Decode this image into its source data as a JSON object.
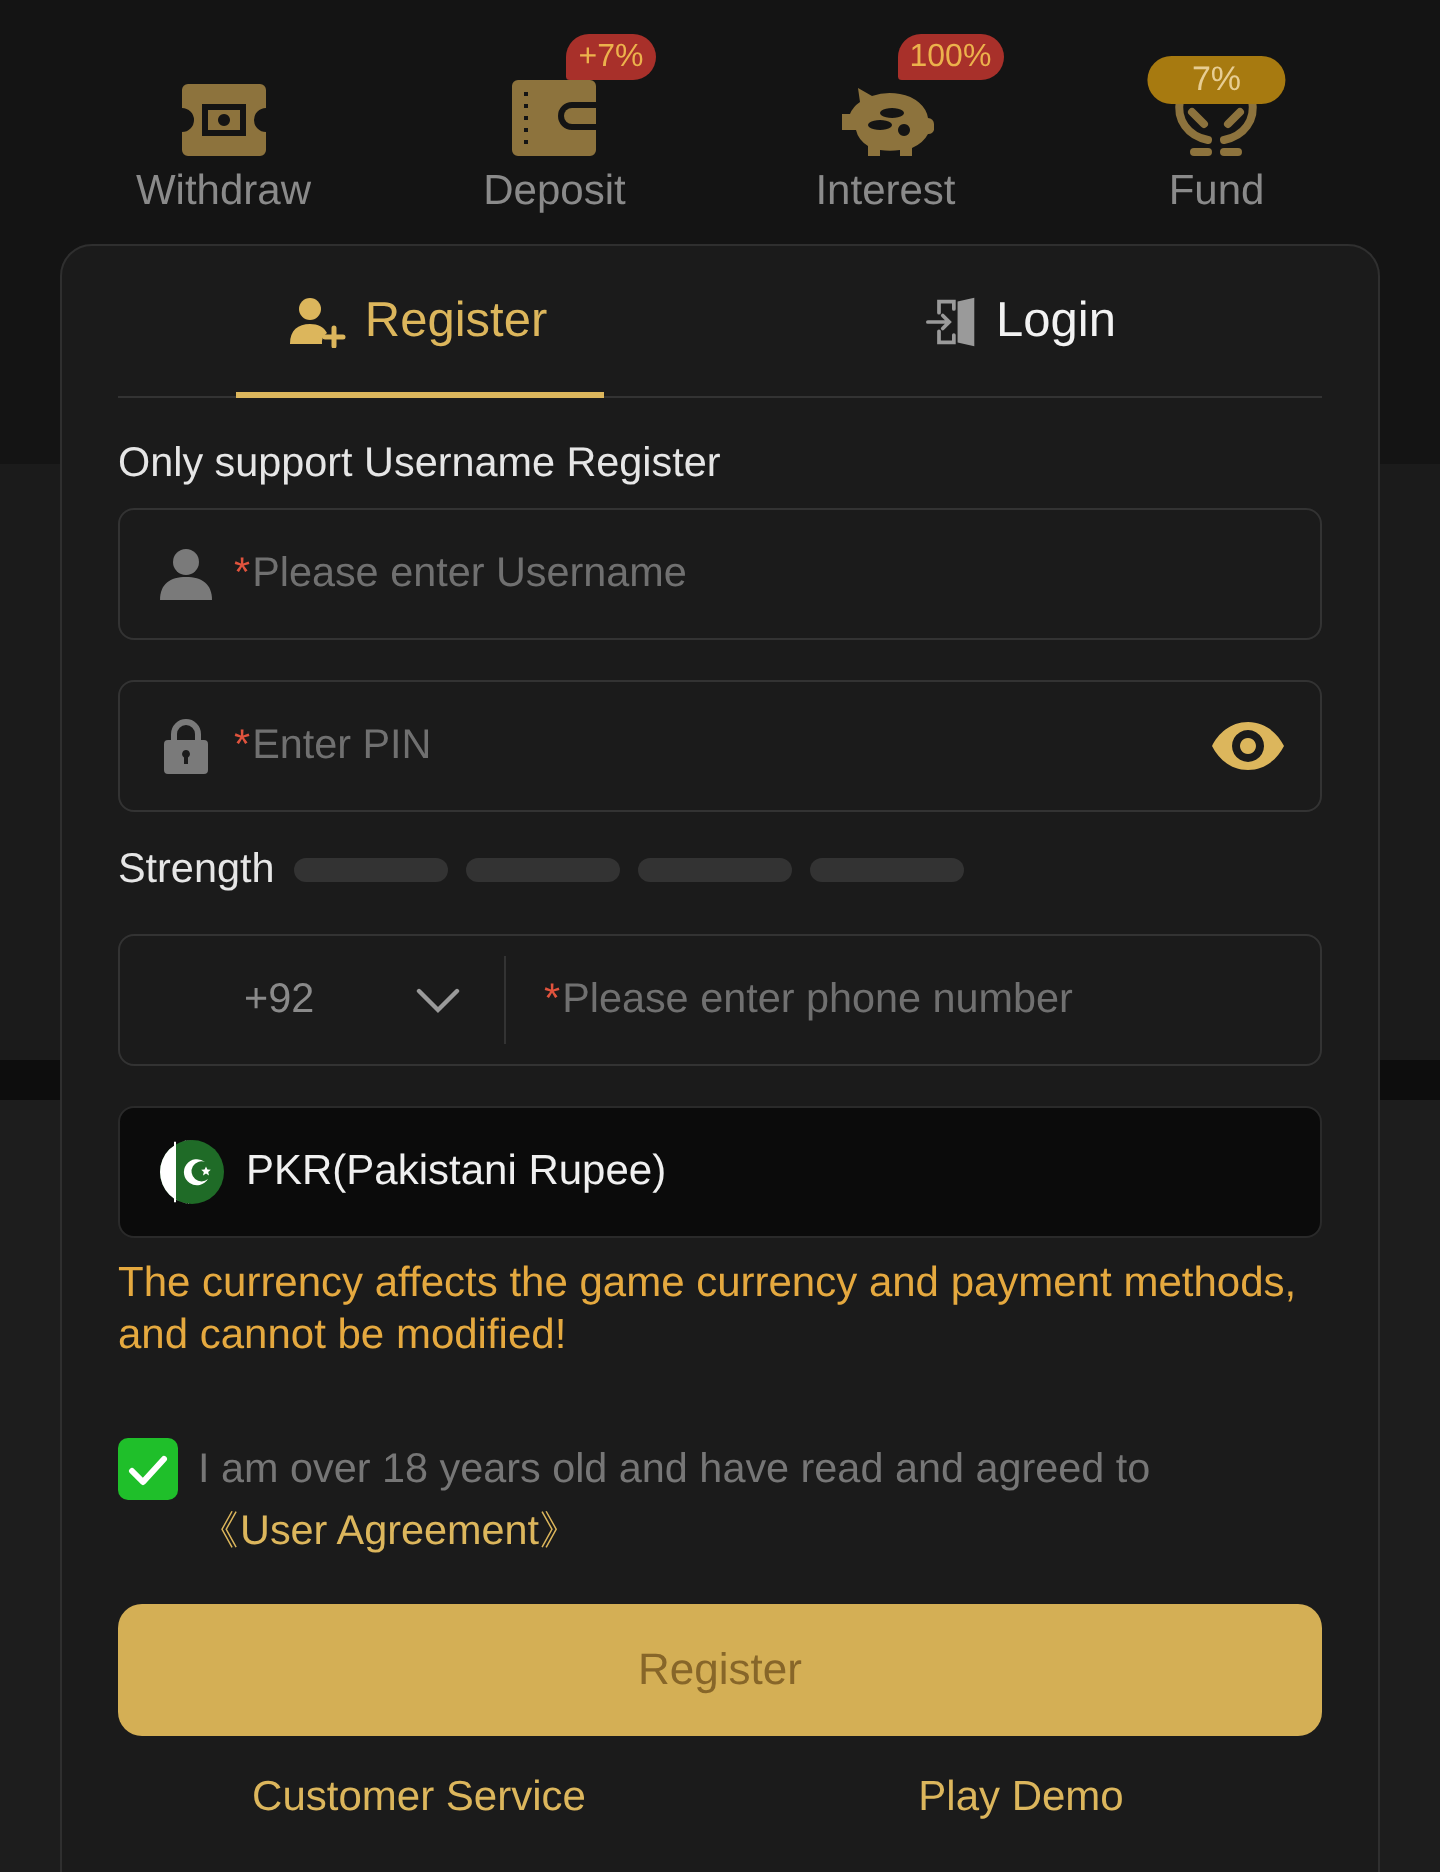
{
  "shortcuts": [
    {
      "label": "Withdraw"
    },
    {
      "label": "Deposit",
      "badge": {
        "text": "+7%",
        "kind": "bubble",
        "color": "#a8302a"
      }
    },
    {
      "label": "Interest",
      "badge": {
        "text": "100%",
        "kind": "bubble",
        "color": "#a8302a"
      }
    },
    {
      "label": "Fund",
      "badge": {
        "text": "7%",
        "kind": "pill",
        "color": "#a77a10"
      }
    }
  ],
  "tabs": [
    {
      "label": "Register",
      "selected": true
    },
    {
      "label": "Login",
      "selected": false
    }
  ],
  "form": {
    "notice": "Only support Username Register",
    "username": {
      "required_mark": "*",
      "placeholder": "Please enter Username"
    },
    "pin": {
      "required_mark": "*",
      "placeholder": "Enter PIN"
    },
    "strength": {
      "label": "Strength",
      "level": 0
    },
    "phone": {
      "country_code": "+92",
      "required_mark": "*",
      "placeholder": "Please enter phone number"
    },
    "currency": {
      "value": "PKR(Pakistani Rupee)"
    },
    "currency_warning": "The currency affects the game currency and payment methods, and cannot be modified!",
    "agreement": {
      "checked": true,
      "text": "I am over 18 years old and have read and agreed to",
      "link": "《User Agreement》"
    },
    "submit": "Register"
  },
  "links": [
    "Customer Service",
    "Play Demo"
  ]
}
